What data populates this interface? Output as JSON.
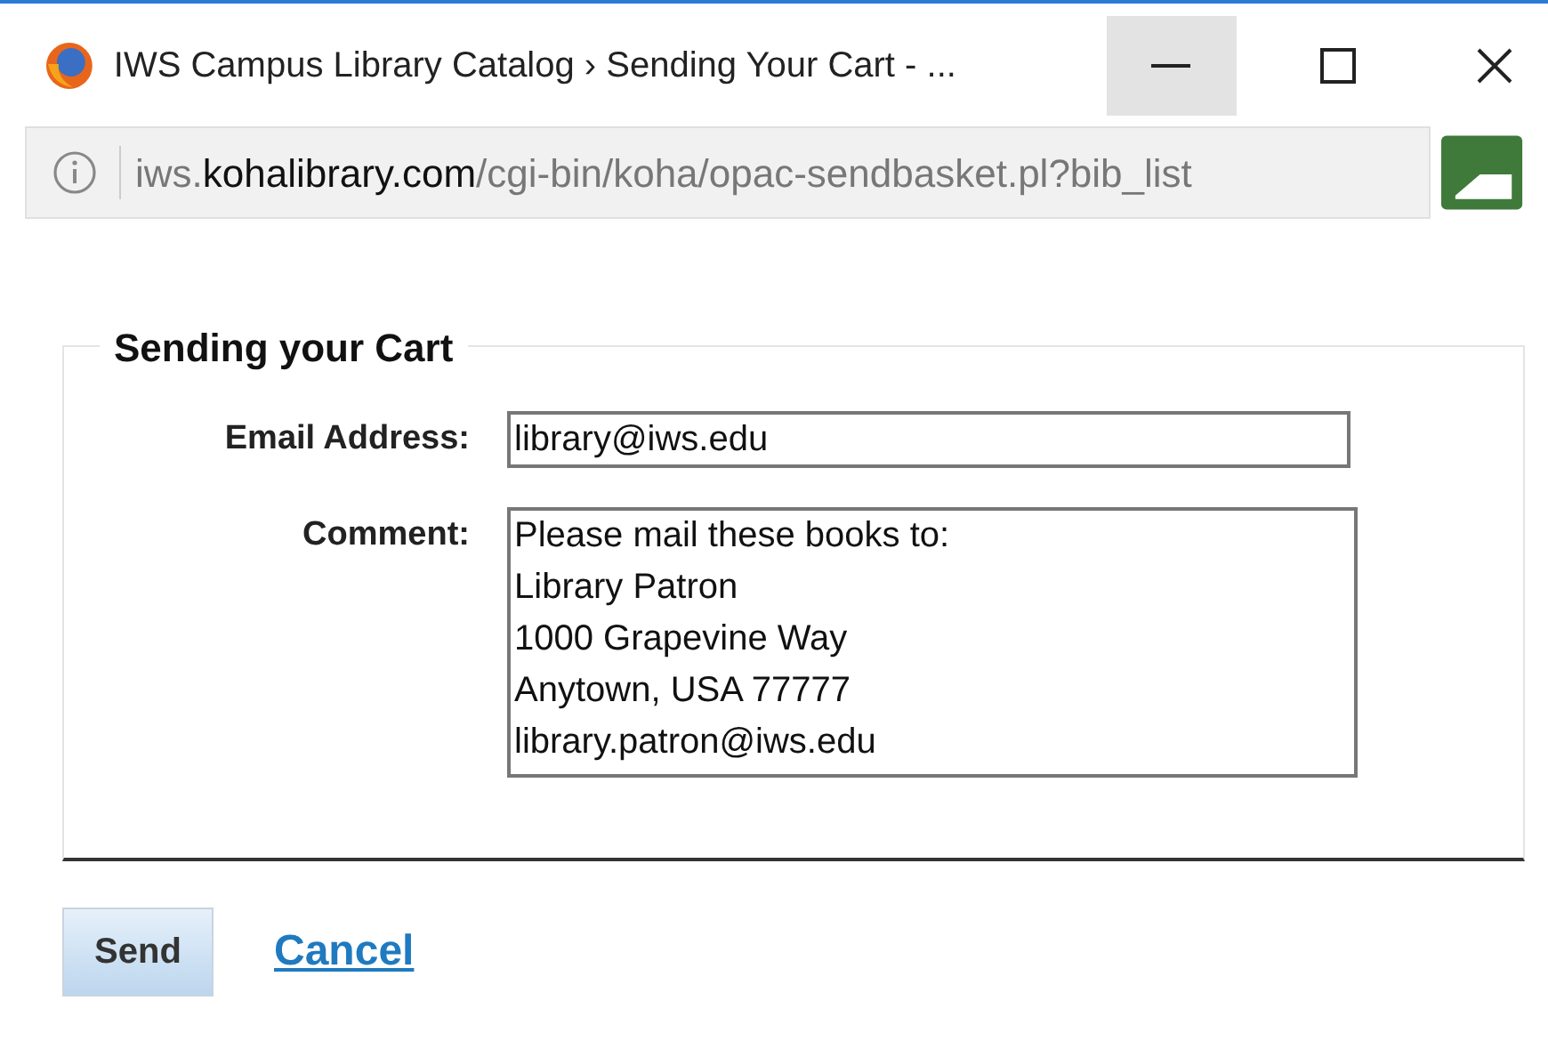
{
  "window": {
    "title": "IWS Campus Library Catalog › Sending Your Cart - ..."
  },
  "address_bar": {
    "prefix": "iws.",
    "domain": "kohalibrary.com",
    "path": "/cgi-bin/koha/opac-sendbasket.pl?bib_list"
  },
  "form": {
    "legend": "Sending your Cart",
    "fields": [
      {
        "kind": "input",
        "label": "Email Address:",
        "value": "library@iws.edu"
      },
      {
        "kind": "textarea",
        "label": "Comment:",
        "value": "Please mail these books to:\nLibrary Patron\n1000 Grapevine Way\nAnytown, USA 77777\nlibrary.patron@iws.edu"
      }
    ]
  },
  "actions": {
    "send": "Send",
    "cancel": "Cancel"
  }
}
